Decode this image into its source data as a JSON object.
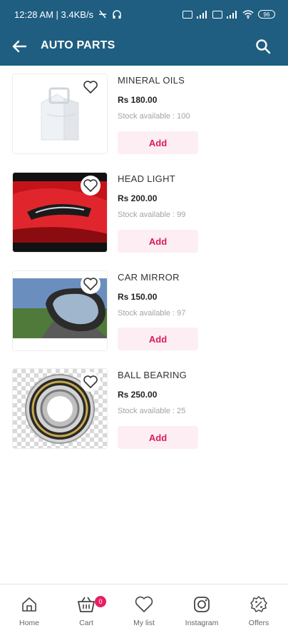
{
  "status_bar": {
    "time_speed": "12:28 AM | 3.4KB/s",
    "battery": "96"
  },
  "header": {
    "title": "AUTO PARTS",
    "back_icon": "arrow-left-icon",
    "search_icon": "search-icon"
  },
  "products": [
    {
      "name": "MINERAL OILS",
      "price": "Rs 180.00",
      "stock": "Stock available : 100",
      "add_label": "Add",
      "image": "white-paper-bag-image"
    },
    {
      "name": "HEAD LIGHT",
      "price": "Rs 200.00",
      "stock": "Stock available : 99",
      "add_label": "Add",
      "image": "red-car-headlight-image"
    },
    {
      "name": "CAR MIRROR",
      "price": "Rs 150.00",
      "stock": "Stock available : 97",
      "add_label": "Add",
      "image": "car-side-mirror-image"
    },
    {
      "name": "BALL BEARING",
      "price": "Rs 250.00",
      "stock": "Stock available : 25",
      "add_label": "Add",
      "image": "ball-bearing-image"
    }
  ],
  "bottom_nav": {
    "items": [
      {
        "label": "Home",
        "icon": "home-icon"
      },
      {
        "label": "Cart",
        "icon": "cart-icon",
        "badge": "0"
      },
      {
        "label": "My list",
        "icon": "heart-icon"
      },
      {
        "label": "Instagram",
        "icon": "instagram-icon"
      },
      {
        "label": "Offers",
        "icon": "offers-icon"
      }
    ]
  },
  "colors": {
    "header_bg": "#1f5e80",
    "accent": "#d81b60",
    "add_bg": "#fdeef3",
    "badge": "#e91e63"
  }
}
